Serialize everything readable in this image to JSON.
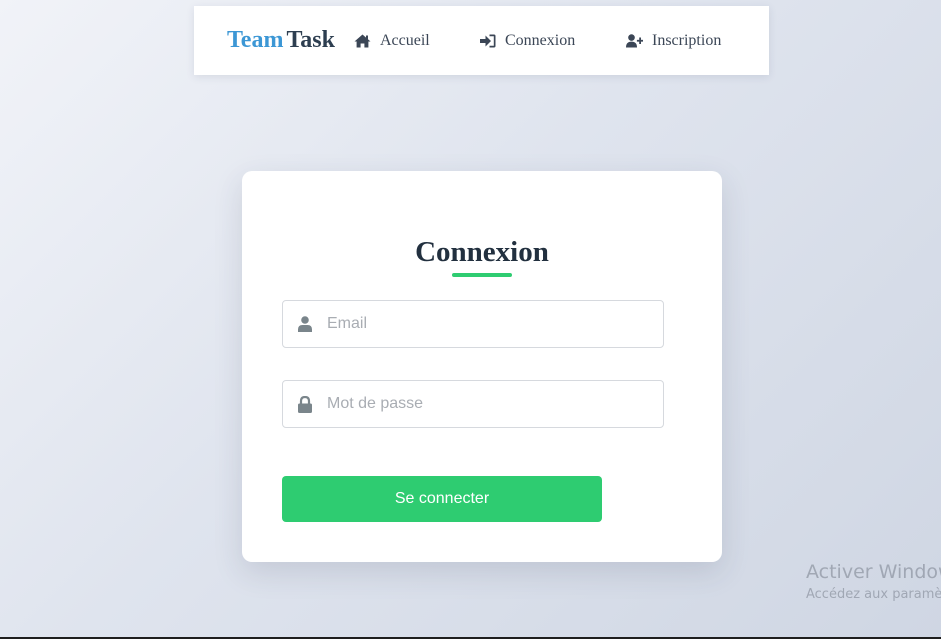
{
  "navbar": {
    "brand_first": "Team",
    "brand_second": "Task",
    "links": [
      {
        "label": "Accueil",
        "icon": "home-icon"
      },
      {
        "label": "Connexion",
        "icon": "sign-in-icon"
      },
      {
        "label": "Inscription",
        "icon": "user-plus-icon"
      }
    ]
  },
  "login_form": {
    "title": "Connexion",
    "email": {
      "placeholder": "Email",
      "value": "",
      "icon": "user-icon"
    },
    "password": {
      "placeholder": "Mot de passe",
      "value": "",
      "icon": "lock-icon"
    },
    "submit_label": "Se connecter"
  },
  "watermark": {
    "title": "Activer Windows",
    "subtitle": "Accédez aux paramètres pour activer Windows."
  },
  "colors": {
    "accent_green": "#2ecc71",
    "brand_blue": "#3c97d5",
    "brand_dark": "#2d3e50",
    "text_dark": "#22303f"
  }
}
